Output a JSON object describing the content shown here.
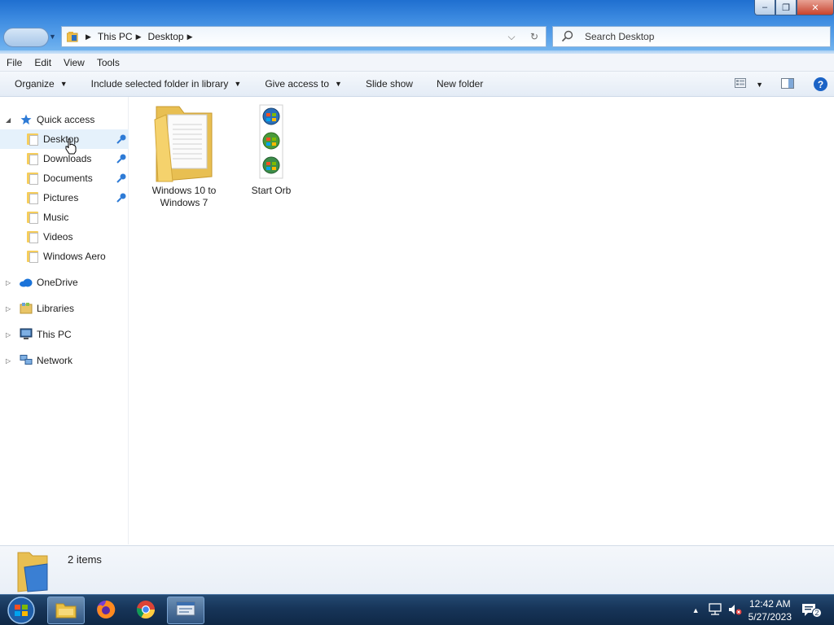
{
  "window": {
    "controls": {
      "minimize": "–",
      "maximize": "❐",
      "close": "✕"
    }
  },
  "address_bar": {
    "breadcrumbs": [
      "This PC",
      "Desktop"
    ],
    "dropdown_icon": "⌵",
    "refresh_icon": "↻"
  },
  "search": {
    "placeholder": "Search Desktop"
  },
  "menu": [
    "File",
    "Edit",
    "View",
    "Tools"
  ],
  "toolbar": {
    "organize": "Organize",
    "include_library": "Include selected folder in library",
    "give_access": "Give access to",
    "slide_show": "Slide show",
    "new_folder": "New folder",
    "help": "?"
  },
  "nav": {
    "quick_access": "Quick access",
    "quick_items": [
      {
        "label": "Desktop",
        "pinned": true
      },
      {
        "label": "Downloads",
        "pinned": true
      },
      {
        "label": "Documents",
        "pinned": true
      },
      {
        "label": "Pictures",
        "pinned": true
      },
      {
        "label": "Music",
        "pinned": false
      },
      {
        "label": "Videos",
        "pinned": false
      },
      {
        "label": "Windows Aero",
        "pinned": false
      }
    ],
    "roots": [
      "OneDrive",
      "Libraries",
      "This PC",
      "Network"
    ]
  },
  "content": {
    "items": [
      {
        "line1": "Windows 10 to",
        "line2": "Windows 7",
        "icon": "folder-icon"
      },
      {
        "line1": "Start Orb",
        "line2": "",
        "icon": "start-orb-file-icon"
      }
    ]
  },
  "status": {
    "count": "2 items"
  },
  "taskbar": {
    "time": "12:42 AM",
    "date": "5/27/2023",
    "notification_count": "2",
    "tray_up": "▲"
  },
  "colors": {
    "accent": "#1b63c6",
    "folder": "#f5cd5b",
    "selection": "#e5f1fb"
  }
}
